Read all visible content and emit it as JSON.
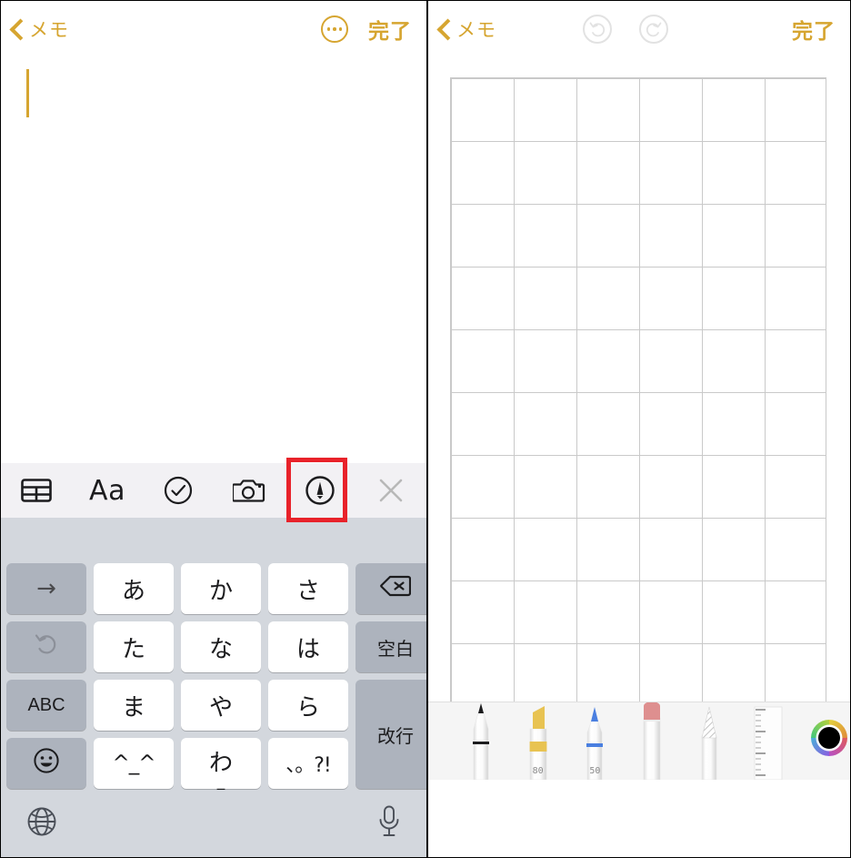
{
  "app": {
    "platform": "ios-notes",
    "accent_color": "#d6a530",
    "highlight_color": "#e8222a",
    "keyboard_bg": "#d3d7dd",
    "toolbar_bg": "#f2f1f4",
    "palette_bg": "#f5f5f5",
    "grid_line_color": "#c9c9c9"
  },
  "left_panel": {
    "navbar": {
      "back_label": "メモ",
      "back_icon": "chevron-left-icon",
      "more_icon": "more-circle-icon",
      "done_label": "完了"
    },
    "note": {
      "body_text": "",
      "caret_visible": true
    },
    "accessory_toolbar": {
      "items": [
        {
          "name": "table-icon",
          "label": ""
        },
        {
          "name": "format-aa-icon",
          "label": "Aa"
        },
        {
          "name": "checklist-icon",
          "label": ""
        },
        {
          "name": "camera-icon",
          "label": ""
        },
        {
          "name": "markup-pen-icon",
          "label": "",
          "highlighted": true
        },
        {
          "name": "close-icon",
          "label": ""
        }
      ]
    },
    "keyboard": {
      "type": "japanese-kana-10key",
      "rows": [
        [
          {
            "name": "key-cursor-right",
            "label": "→",
            "kind": "function"
          },
          {
            "name": "key-a",
            "label": "あ",
            "kind": "char"
          },
          {
            "name": "key-ka",
            "label": "か",
            "kind": "char"
          },
          {
            "name": "key-sa",
            "label": "さ",
            "kind": "char"
          },
          {
            "name": "key-backspace",
            "label": "",
            "kind": "function",
            "icon": "backspace-icon"
          }
        ],
        [
          {
            "name": "key-undo",
            "label": "",
            "kind": "function",
            "icon": "undo-arrow-icon"
          },
          {
            "name": "key-ta",
            "label": "た",
            "kind": "char"
          },
          {
            "name": "key-na",
            "label": "な",
            "kind": "char"
          },
          {
            "name": "key-ha",
            "label": "は",
            "kind": "char"
          },
          {
            "name": "key-space",
            "label": "空白",
            "kind": "function"
          }
        ],
        [
          {
            "name": "key-abc",
            "label": "ABC",
            "kind": "function"
          },
          {
            "name": "key-ma",
            "label": "ま",
            "kind": "char"
          },
          {
            "name": "key-ya",
            "label": "や",
            "kind": "char"
          },
          {
            "name": "key-ra",
            "label": "ら",
            "kind": "char"
          },
          {
            "name": "key-return",
            "label": "改行",
            "kind": "function"
          }
        ],
        [
          {
            "name": "key-emoji",
            "label": "",
            "kind": "function",
            "icon": "smiley-icon"
          },
          {
            "name": "key-kaomoji",
            "label": "^_^",
            "kind": "char"
          },
          {
            "name": "key-wa",
            "label": "わ",
            "sublabel": "_",
            "kind": "char"
          },
          {
            "name": "key-punctuation",
            "label": "、。?!",
            "kind": "char"
          }
        ]
      ],
      "bottom": {
        "globe_icon": "globe-icon",
        "mic_icon": "microphone-icon"
      }
    }
  },
  "right_panel": {
    "navbar": {
      "back_label": "メモ",
      "back_icon": "chevron-left-icon",
      "undo_icon": "undo-icon",
      "redo_icon": "redo-icon",
      "undo_enabled": false,
      "redo_enabled": false,
      "done_label": "完了"
    },
    "canvas": {
      "paper_style": "grid",
      "grid_columns": 6,
      "grid_rows": 11,
      "cell_size_px": 69
    },
    "tool_palette": {
      "tools": [
        {
          "name": "pen-tool",
          "label": "",
          "color": "#1c1c1e"
        },
        {
          "name": "highlighter-tool",
          "label": "80",
          "color": "#e8c352"
        },
        {
          "name": "marker-pen-tool",
          "label": "50",
          "color": "#4a7fe0"
        },
        {
          "name": "eraser-tool",
          "label": "",
          "color": "#de8f8f"
        },
        {
          "name": "lasso-pencil-tool",
          "label": "",
          "color": "#cccccc"
        },
        {
          "name": "ruler-tool",
          "label": "",
          "color": "#9a9a9a"
        }
      ],
      "color_picker": {
        "name": "color-wheel",
        "selected_color": "#000000"
      }
    }
  }
}
